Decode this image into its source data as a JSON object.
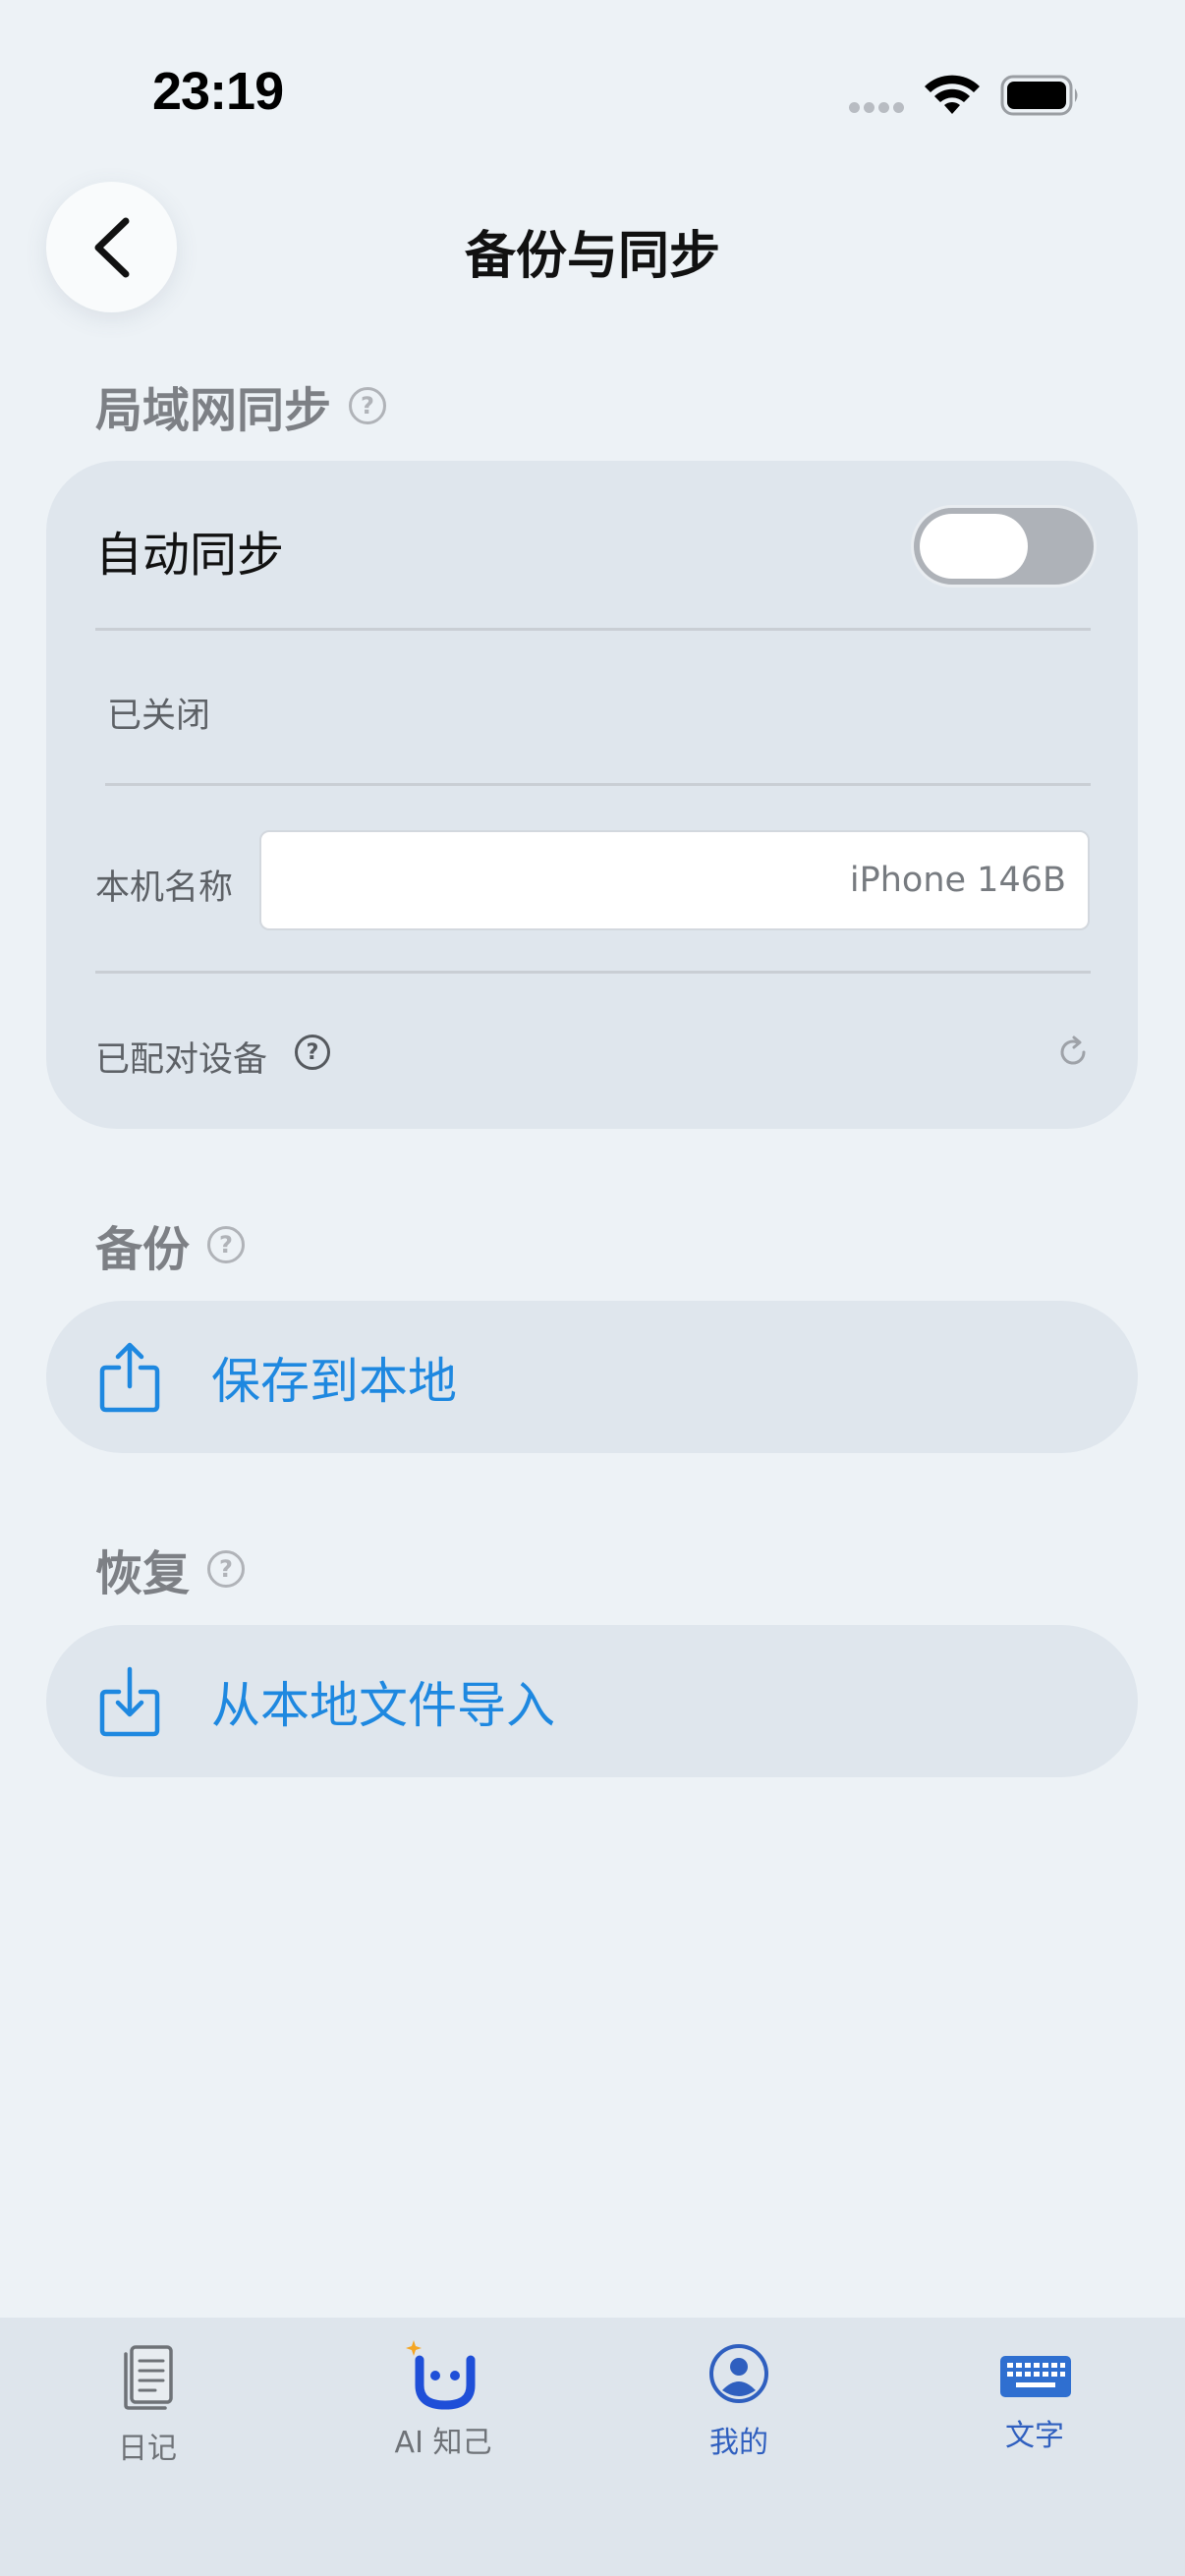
{
  "status_bar": {
    "time": "23:19"
  },
  "header": {
    "title": "备份与同步"
  },
  "lan_sync": {
    "section_title": "局域网同步",
    "help_glyph": "?",
    "auto_sync_label": "自动同步",
    "auto_sync_enabled": false,
    "status_text": "已关闭",
    "device_name_label": "本机名称",
    "device_name_value": "iPhone 146B",
    "paired_devices_label": "已配对设备"
  },
  "backup": {
    "section_title": "备份",
    "save_local_label": "保存到本地"
  },
  "restore": {
    "section_title": "恢复",
    "import_local_label": "从本地文件导入"
  },
  "tabbar": {
    "tabs": [
      {
        "label": "日记",
        "icon": "diary-icon"
      },
      {
        "label": "AI 知己",
        "icon": "ai-companion-icon"
      },
      {
        "label": "我的",
        "icon": "profile-icon"
      },
      {
        "label": "文字",
        "icon": "keyboard-icon"
      }
    ]
  },
  "colors": {
    "accent": "#1e88e0",
    "tab_active": "#2f5fbf",
    "background": "#edf2f6",
    "card": "#dfe6ed"
  }
}
